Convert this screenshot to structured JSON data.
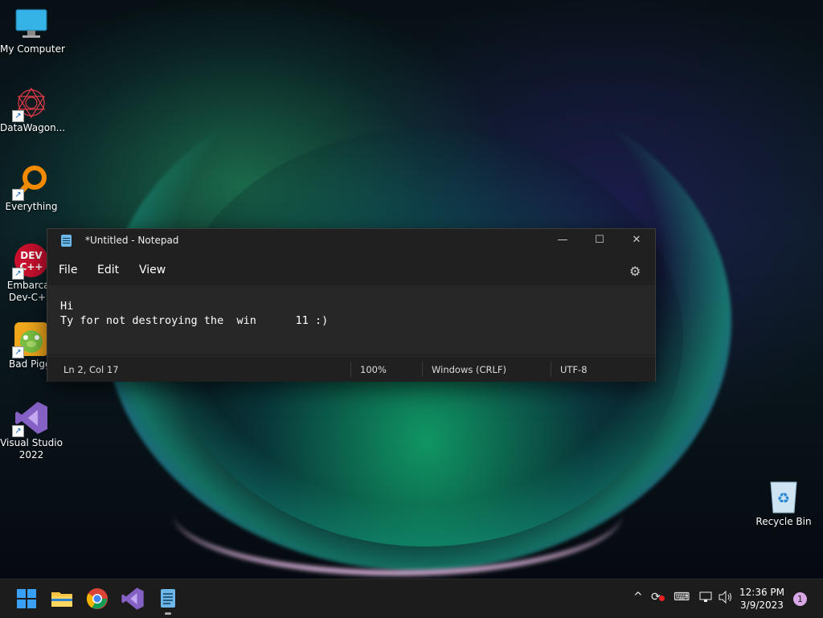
{
  "desktop": {
    "icons": [
      {
        "label": "My Computer"
      },
      {
        "label": "DataWagon..."
      },
      {
        "label": "Everything"
      },
      {
        "label": "Embarcad\nDev-C++"
      },
      {
        "label": "Bad Piggi"
      },
      {
        "label": "Visual Studio\n2022"
      },
      {
        "label": "Recycle Bin"
      }
    ],
    "icon_names": [
      "computer-icon",
      "datawagon-icon",
      "everything-icon",
      "devcpp-icon",
      "bad-piggies-icon",
      "visual-studio-icon",
      "recycle-bin-icon"
    ]
  },
  "notepad": {
    "title": "*Untitled - Notepad",
    "menu": {
      "file": "File",
      "edit": "Edit",
      "view": "View"
    },
    "content": {
      "line1": "Hi",
      "line2": "Ty for not destroying the  win      11 :)"
    },
    "status": {
      "position": "Ln 2, Col 17",
      "zoom": "100%",
      "line_endings": "Windows (CRLF)",
      "encoding": "UTF-8"
    },
    "window_buttons": {
      "minimize": "—",
      "maximize": "☐",
      "close": "✕"
    },
    "settings_icon": "⚙"
  },
  "taskbar": {
    "pinned": [
      "start-icon",
      "file-explorer-icon",
      "chrome-icon",
      "visual-studio-icon",
      "notepad-icon"
    ],
    "tray": {
      "chevron": "^"
    },
    "clock": {
      "time": "12:36 PM",
      "date": "3/9/2023"
    },
    "notifications": "1"
  },
  "colors": {
    "accent": "#6cb6e8",
    "taskbar": "#1c1c1c",
    "notepad_bg": "#202020"
  }
}
